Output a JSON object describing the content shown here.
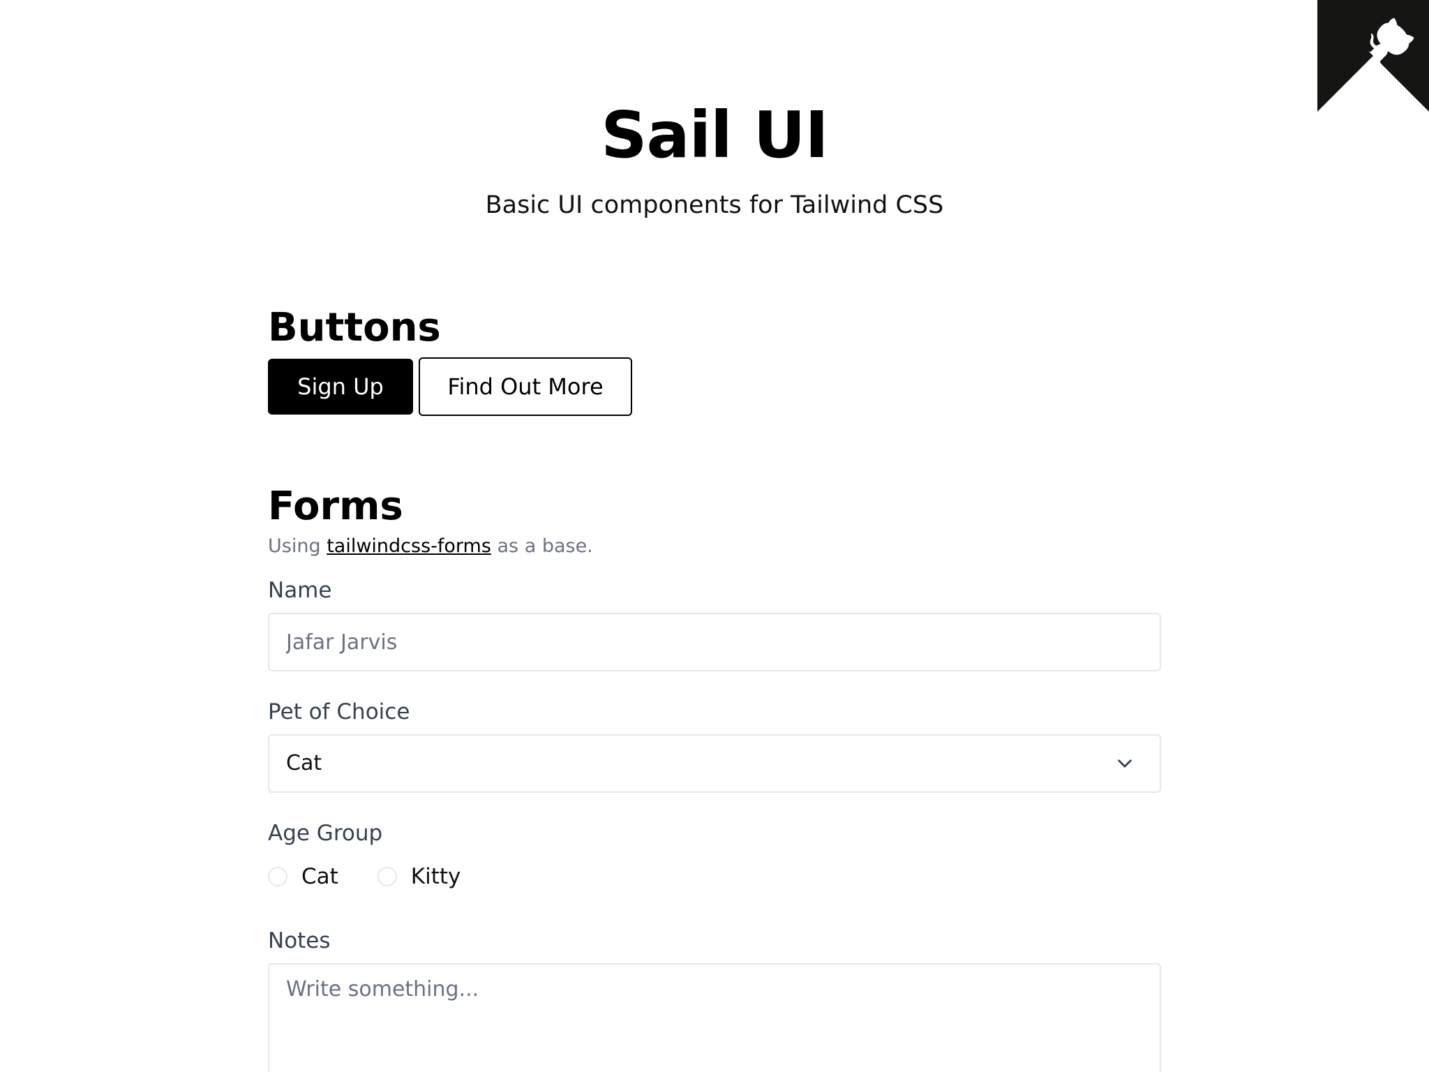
{
  "corner": {
    "icon": "github-octocat-icon",
    "bg_color": "#151513"
  },
  "header": {
    "title": "Sail UI",
    "subtitle": "Basic UI components for Tailwind CSS"
  },
  "buttons_section": {
    "heading": "Buttons",
    "primary_label": "Sign Up",
    "secondary_label": "Find Out More"
  },
  "forms_section": {
    "heading": "Forms",
    "note_prefix": "Using",
    "note_link": "tailwindcss-forms",
    "note_suffix": "as a base.",
    "name": {
      "label": "Name",
      "placeholder": "Jafar Jarvis",
      "value": ""
    },
    "pet": {
      "label": "Pet of Choice",
      "selected": "Cat",
      "icon": "chevron-down-icon"
    },
    "age_group": {
      "label": "Age Group",
      "options": [
        {
          "label": "Cat",
          "checked": false
        },
        {
          "label": "Kitty",
          "checked": false
        }
      ]
    },
    "notes": {
      "label": "Notes",
      "placeholder": "Write something..."
    }
  }
}
